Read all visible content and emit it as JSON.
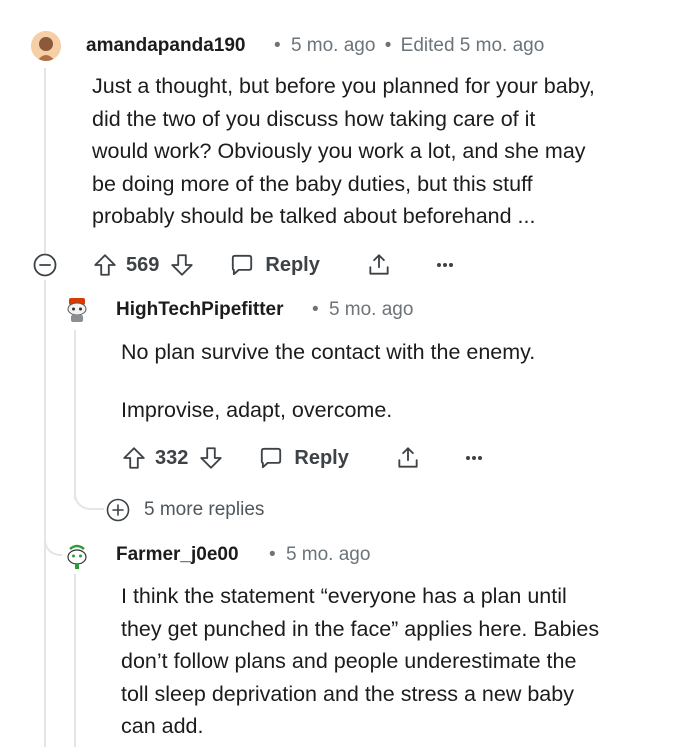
{
  "comments": [
    {
      "username": "amandapanda190",
      "time": "5 mo. ago",
      "edited": "Edited 5 mo. ago",
      "body_lines": [
        "Just a thought, but before you planned for your baby,",
        "did the two of you discuss how taking care of it",
        "would work? Obviously you work a lot, and she may",
        "be doing more of the baby duties, but this stuff",
        "probably should be talked about beforehand ..."
      ],
      "score": "569",
      "reply_label": "Reply"
    },
    {
      "username": "HighTechPipefitter",
      "time": "5 mo. ago",
      "body_paragraphs": [
        "No plan survive the contact with the enemy.",
        "Improvise, adapt, overcome."
      ],
      "score": "332",
      "reply_label": "Reply"
    },
    {
      "username": "Farmer_j0e00",
      "time": "5 mo. ago",
      "body_lines": [
        "I think the statement “everyone has a plan until",
        "they get punched in the face” applies here. Babies",
        "don’t follow plans and people underestimate the",
        "toll sleep deprivation and the stress a new baby",
        "can add."
      ]
    }
  ],
  "more_replies_label": "5 more replies",
  "separator": "•",
  "icons": [
    "collapse-icon",
    "upvote-icon",
    "downvote-icon",
    "comment-icon",
    "share-icon",
    "more-options-icon",
    "expand-icon"
  ],
  "colors": {
    "meta": "#6b7479",
    "thread_line": "#e3e6e8",
    "text": "#1c1c1c",
    "action": "#3c4246"
  }
}
